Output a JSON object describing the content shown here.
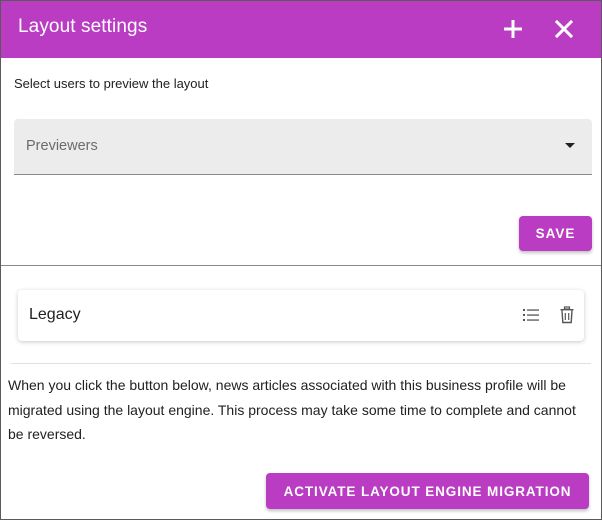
{
  "dialog": {
    "title": "Layout settings",
    "header_icons": [
      "plus-icon",
      "close-icon"
    ]
  },
  "previewers": {
    "prompt": "Select users to preview the layout",
    "placeholder": "Previewers",
    "save_label": "SAVE"
  },
  "layouts": [
    {
      "name": "Legacy",
      "icons": [
        "list-icon",
        "trash-icon"
      ]
    }
  ],
  "migration": {
    "notice": "When you click the button below, news articles associated with this business profile will be migrated using the layout engine. This process may take some time to complete and cannot be reversed.",
    "button_label": "ACTIVATE LAYOUT ENGINE MIGRATION"
  },
  "colors": {
    "accent": "#b93cc3",
    "select_background": "#ececec"
  }
}
